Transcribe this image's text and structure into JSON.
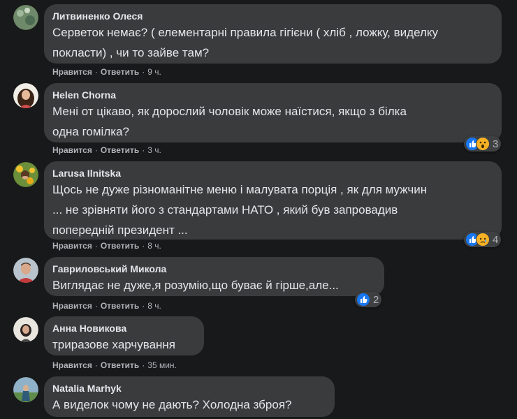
{
  "actions": {
    "like": "Нравится",
    "reply": "Ответить",
    "sep": "·"
  },
  "comments": [
    {
      "author": "Литвиненко Олеся",
      "text": "Серветок немає? ( елементарні правила гігієни ( хліб , ложку, виделку\nпокласти) , чи то зайве там?",
      "time": "9 ч.",
      "reactions": []
    },
    {
      "author": "Helen Chorna",
      "text": "Мені от цікаво, як дорослий чоловік може наїстися, якщо з білка\nодна гомілка?",
      "time": "3 ч.",
      "reactions": [
        "like-icon",
        "wow-icon"
      ],
      "reaction_count": "3"
    },
    {
      "author": "Larusa Ilnitska",
      "text": "Щось не дуже різноманітне меню і малувата порція , як для мужчин\n... не зрівняти його з стандартами НАТО , який був запровадив\nпопередній президент ...",
      "time": "8 ч.",
      "reactions": [
        "like-icon",
        "sad-icon"
      ],
      "reaction_count": "4"
    },
    {
      "author": "Гавриловський Микола",
      "text": "Виглядає не дуже,я розумію,що буває й гірше,але...",
      "time": "8 ч.",
      "reactions": [
        "like-icon"
      ],
      "reaction_count": "2"
    },
    {
      "author": "Анна Новикова",
      "text": "триразове харчування",
      "time": "35 мин.",
      "reactions": []
    },
    {
      "author": "Natalia Marhyk",
      "text": "А виделок чому не дають? Холодна зброя?",
      "reactions": []
    }
  ]
}
